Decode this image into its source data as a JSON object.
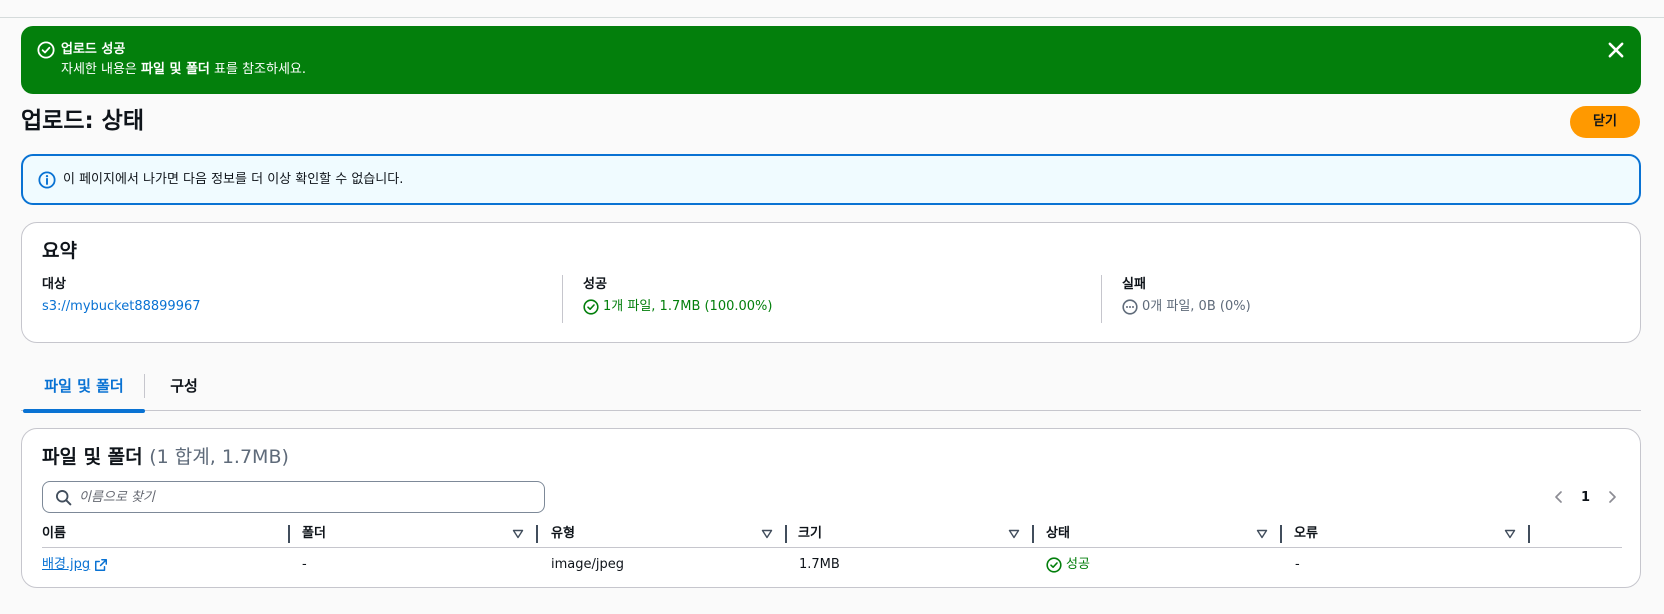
{
  "flash": {
    "title": "업로드 성공",
    "desc_prefix": "자세한 내용은 ",
    "desc_bold": "파일 및 폴더",
    "desc_suffix": " 표를 참조하세요."
  },
  "header": {
    "title": "업로드: 상태",
    "close_label": "닫기"
  },
  "info": {
    "text": "이 페이지에서 나가면 다음 정보를 더 이상 확인할 수 없습니다."
  },
  "summary": {
    "title": "요약",
    "destination": {
      "label": "대상",
      "value": "s3://mybucket88899967"
    },
    "succeeded": {
      "label": "성공",
      "value": "1개 파일, 1.7MB (100.00%)"
    },
    "failed": {
      "label": "실패",
      "value": "0개 파일, 0B (0%)"
    }
  },
  "tabs": [
    {
      "label": "파일 및 폴더",
      "active": true
    },
    {
      "label": "구성",
      "active": false
    }
  ],
  "files": {
    "title": "파일 및 폴더",
    "count": "(1 합계, 1.7MB)",
    "search_placeholder": "이름으로 찾기",
    "page": "1",
    "columns": [
      "이름",
      "폴더",
      "유형",
      "크기",
      "상태",
      "오류"
    ],
    "rows": [
      {
        "name": "배경.jpg",
        "folder": "-",
        "type": "image/jpeg",
        "size": "1.7MB",
        "status": "성공",
        "error": "-"
      }
    ]
  },
  "colors": {
    "success": "#037f0c",
    "link": "#0972d3",
    "primary_button": "#ff9900",
    "info_bg": "#f0fbff"
  }
}
